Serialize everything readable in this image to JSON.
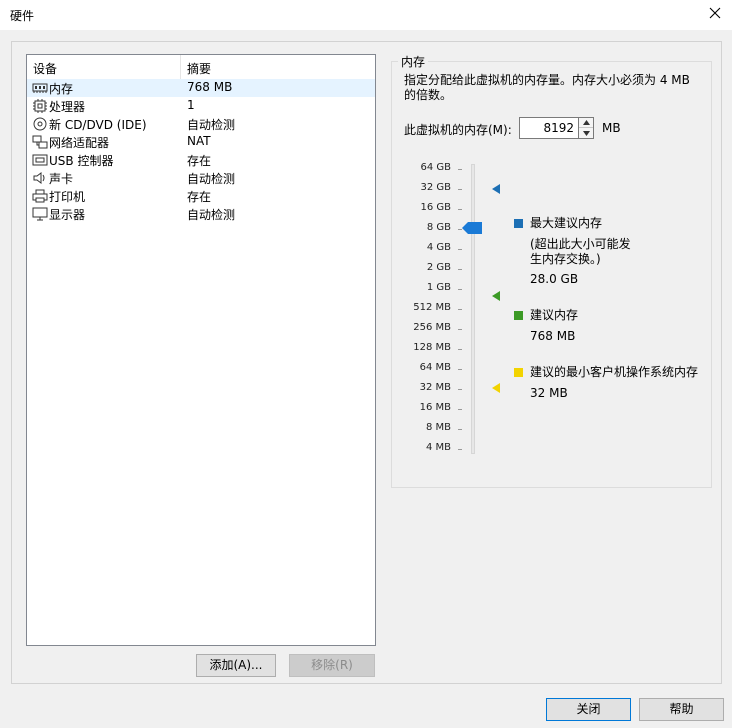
{
  "window": {
    "title": "硬件"
  },
  "device_list": {
    "columns": {
      "device": "设备",
      "summary": "摘要"
    },
    "rows": [
      {
        "icon": "memory-icon",
        "name": "内存",
        "summary": "768 MB",
        "selected": true
      },
      {
        "icon": "cpu-icon",
        "name": "处理器",
        "summary": "1"
      },
      {
        "icon": "cd-icon",
        "name": "新 CD/DVD (IDE)",
        "summary": "自动检测"
      },
      {
        "icon": "network-icon",
        "name": "网络适配器",
        "summary": "NAT"
      },
      {
        "icon": "usb-icon",
        "name": "USB 控制器",
        "summary": "存在"
      },
      {
        "icon": "speaker-icon",
        "name": "声卡",
        "summary": "自动检测"
      },
      {
        "icon": "printer-icon",
        "name": "打印机",
        "summary": "存在"
      },
      {
        "icon": "monitor-icon",
        "name": "显示器",
        "summary": "自动检测"
      }
    ]
  },
  "buttons": {
    "add": "添加(A)...",
    "remove": "移除(R)",
    "close": "关闭",
    "help": "帮助"
  },
  "memory": {
    "group_title": "内存",
    "description": "指定分配给此虚拟机的内存量。内存大小必须为 4 MB 的倍数。",
    "field_label": "此虚拟机的内存(M):",
    "value": "8192",
    "unit": "MB",
    "ticks": [
      "64 GB",
      "32 GB",
      "16 GB",
      "8 GB",
      "4 GB",
      "2 GB",
      "1 GB",
      "512 MB",
      "256 MB",
      "128 MB",
      "64 MB",
      "32 MB",
      "16 MB",
      "8 MB",
      "4 MB"
    ],
    "legend": {
      "max": {
        "title": "最大建议内存",
        "note": "(超出此大小可能发生内存交换。)",
        "value": "28.0 GB",
        "color": "#1c6fb4"
      },
      "recommended": {
        "title": "建议内存",
        "value": "768 MB",
        "color": "#3c9a26"
      },
      "min_guest": {
        "title": "建议的最小客户机操作系统内存",
        "value": "32 MB",
        "color": "#f2d300"
      }
    },
    "thumb_color": "#1a7ad6"
  }
}
